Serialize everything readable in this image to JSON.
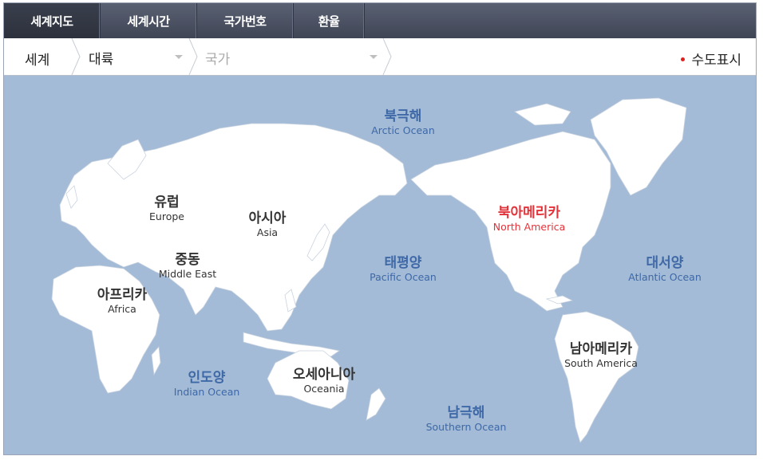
{
  "tabs": [
    {
      "label": "세계지도",
      "active": true
    },
    {
      "label": "세계시간",
      "active": false
    },
    {
      "label": "국가번호",
      "active": false
    },
    {
      "label": "환율",
      "active": false
    }
  ],
  "breadcrumb": {
    "world": "세계",
    "continent_select": "대륙",
    "country_select": "국가"
  },
  "capital_toggle": "수도표시",
  "map": {
    "continents": {
      "europe": {
        "ko": "유럽",
        "en": "Europe"
      },
      "asia": {
        "ko": "아시아",
        "en": "Asia"
      },
      "middle_east": {
        "ko": "중동",
        "en": "Middle East"
      },
      "africa": {
        "ko": "아프리카",
        "en": "Africa"
      },
      "north_america": {
        "ko": "북아메리카",
        "en": "North America"
      },
      "south_america": {
        "ko": "남아메리카",
        "en": "South America"
      },
      "oceania": {
        "ko": "오세아니아",
        "en": "Oceania"
      }
    },
    "oceans": {
      "arctic": {
        "ko": "북극해",
        "en": "Arctic Ocean"
      },
      "pacific": {
        "ko": "태평양",
        "en": "Pacific Ocean"
      },
      "atlantic": {
        "ko": "대서양",
        "en": "Atlantic Ocean"
      },
      "indian": {
        "ko": "인도양",
        "en": "Indian Ocean"
      },
      "southern": {
        "ko": "남극해",
        "en": "Southern Ocean"
      }
    }
  },
  "colors": {
    "ocean": "#a3bbd6",
    "land": "#ffffff",
    "highlight": "#e3333a",
    "ocean_label": "#3e68a6"
  }
}
